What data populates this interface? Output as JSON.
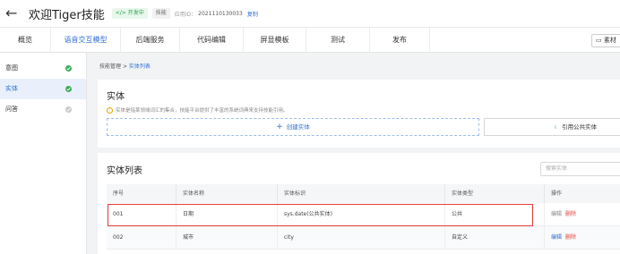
{
  "header": {
    "back_glyph": "←",
    "title": "欢迎Tiger技能",
    "status_badge": "开发中",
    "status_badge_prefix": "</>",
    "type_badge": "技能",
    "app_id_label": "应用ID：",
    "app_id_value": "2021110130033",
    "copy_label": "复制"
  },
  "nav": {
    "tabs": [
      {
        "label": "概览"
      },
      {
        "label": "语音交互模型"
      },
      {
        "label": "后端服务"
      },
      {
        "label": "代码编辑"
      },
      {
        "label": "屏显模板"
      },
      {
        "label": "测试"
      },
      {
        "label": "发布"
      }
    ],
    "right_button_label": "素材"
  },
  "sidebar": {
    "items": [
      {
        "label": "意图"
      },
      {
        "label": "实体"
      },
      {
        "label": "问答"
      }
    ]
  },
  "breadcrumb": {
    "parent": "技能管理",
    "separator": ">",
    "current": "实体列表"
  },
  "entity_card": {
    "title": "实体",
    "info_text": "实体是指某领域词汇的集合，技能平台提供了丰富的系统词典来支持技能引用。",
    "create_label": "创建实体",
    "reference_label": "引用公共实体"
  },
  "list_card": {
    "title": "实体列表",
    "search_placeholder": "搜索实体",
    "columns": [
      "序号",
      "实体名称",
      "实体标识",
      "实体类型",
      "操作"
    ],
    "rows": [
      {
        "index": "001",
        "name": "日期",
        "identifier": "sys.date(公共实体)",
        "type": "公共",
        "edit": "编辑",
        "delete": "删除"
      },
      {
        "index": "002",
        "name": "城市",
        "identifier": "city",
        "type": "自定义",
        "edit": "编辑",
        "delete": "删除"
      }
    ]
  },
  "colors": {
    "accent": "#2f6fd6",
    "success": "#3dab5a",
    "danger": "#e0443e",
    "highlight_box": "#e23b3b"
  }
}
